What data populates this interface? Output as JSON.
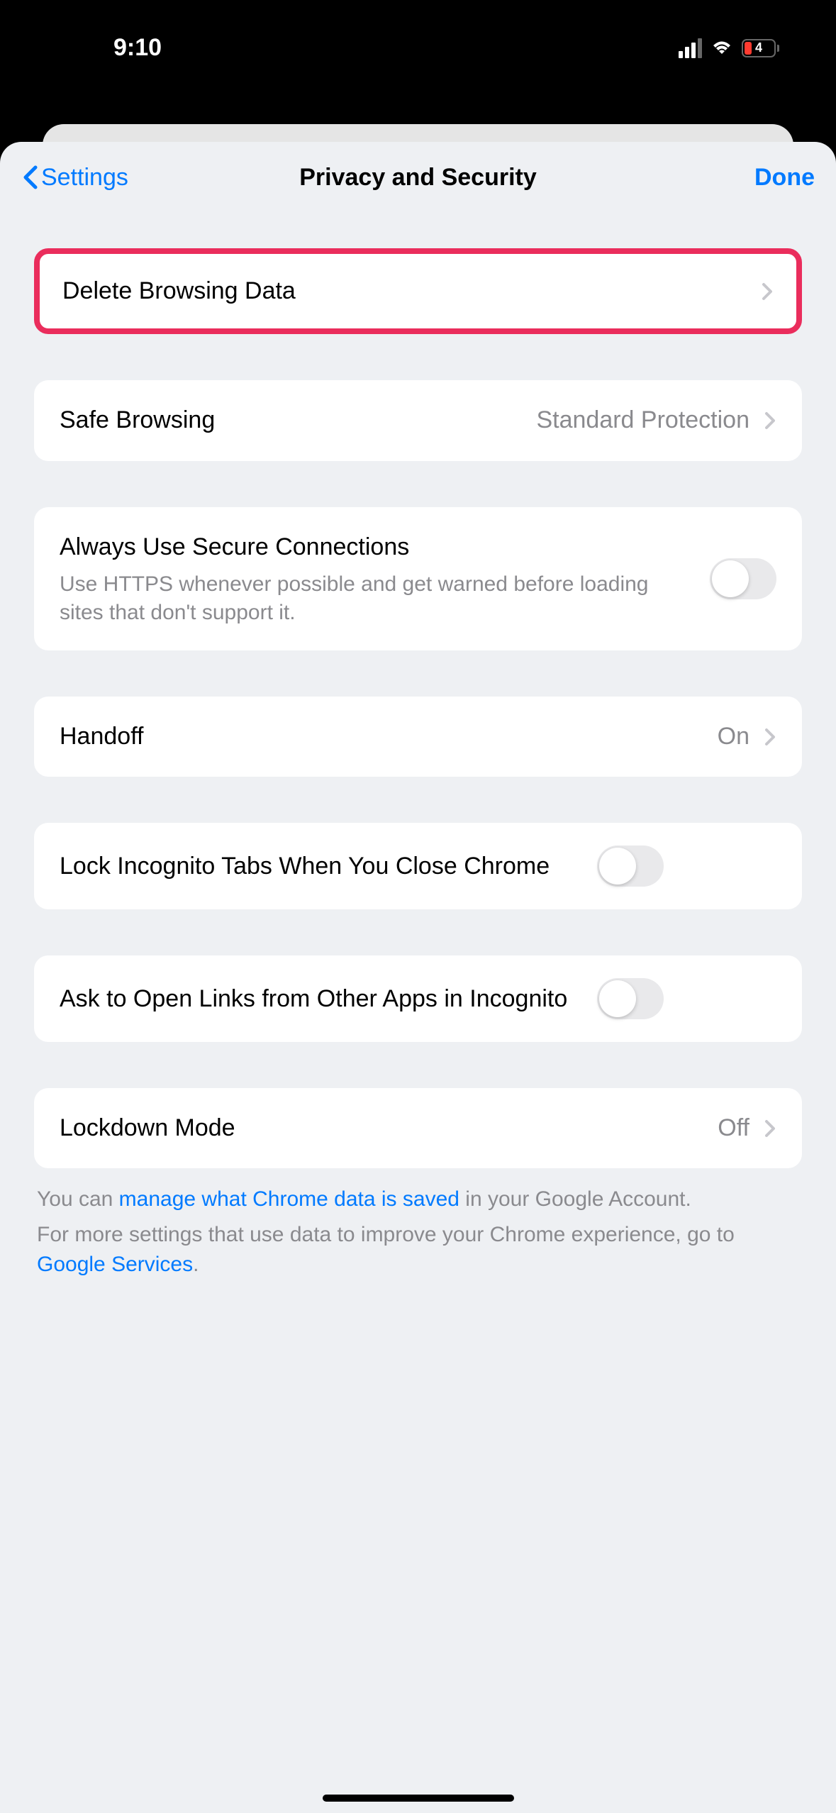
{
  "status": {
    "time": "9:10",
    "battery": "4"
  },
  "nav": {
    "back": "Settings",
    "title": "Privacy and Security",
    "done": "Done"
  },
  "rows": {
    "delete_browsing_data": "Delete Browsing Data",
    "safe_browsing": {
      "label": "Safe Browsing",
      "value": "Standard Protection"
    },
    "secure_connections": {
      "label": "Always Use Secure Connections",
      "desc": "Use HTTPS whenever possible and get warned before loading sites that don't support it."
    },
    "handoff": {
      "label": "Handoff",
      "value": "On"
    },
    "lock_incognito": "Lock Incognito Tabs When You Close Chrome",
    "ask_open_links": "Ask to Open Links from Other Apps in Incognito",
    "lockdown": {
      "label": "Lockdown Mode",
      "value": "Off"
    }
  },
  "footer": {
    "line1_pre": "You can ",
    "line1_link": "manage what Chrome data is saved",
    "line1_post": " in your Google Account.",
    "line2_pre": "For more settings that use data to improve your Chrome experience, go to ",
    "line2_link": "Google Services",
    "line2_post": "."
  }
}
